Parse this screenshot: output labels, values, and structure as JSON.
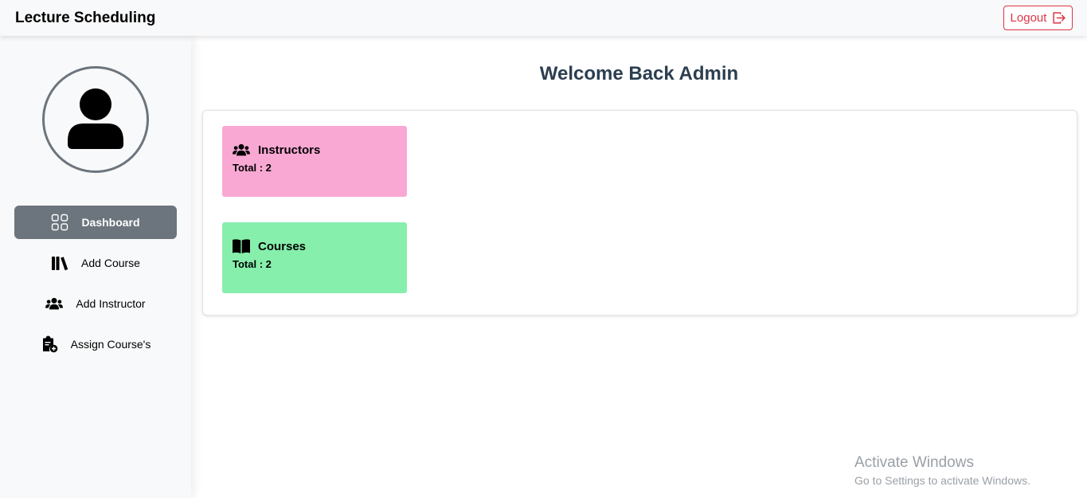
{
  "header": {
    "title": "Lecture Scheduling",
    "logout_label": "Logout"
  },
  "sidebar": {
    "avatar_icon": "user-icon",
    "items": [
      {
        "label": "Dashboard",
        "icon": "grid-icon",
        "active": true
      },
      {
        "label": "Add Course",
        "icon": "books-icon",
        "active": false
      },
      {
        "label": "Add Instructor",
        "icon": "users-icon",
        "active": false
      },
      {
        "label": "Assign Course's",
        "icon": "clipboard-plus-icon",
        "active": false
      }
    ]
  },
  "main": {
    "welcome": "Welcome Back Admin",
    "cards": [
      {
        "title": "Instructors",
        "total": "Total : 2",
        "icon": "users-icon",
        "color": "#f9a8d4"
      },
      {
        "title": "Courses",
        "total": "Total : 2",
        "icon": "book-icon",
        "color": "#86efac"
      }
    ]
  },
  "watermark": {
    "line1": "Activate Windows",
    "line2": "Go to Settings to activate Windows."
  },
  "colors": {
    "accent_active": "#6c757d",
    "logout": "#dc3545",
    "heading": "#2c3e50"
  }
}
